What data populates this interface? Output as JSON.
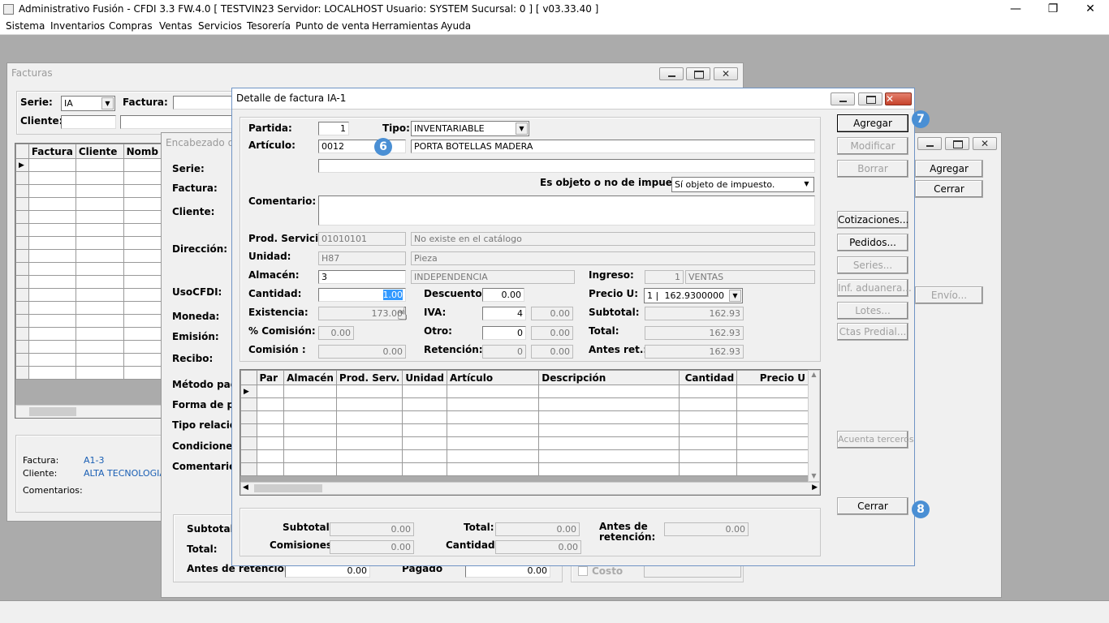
{
  "app": {
    "title": "Administrativo Fusión - CFDI 3.3 FW.4.0 [ TESTVIN23   Servidor: LOCALHOST   Usuario: SYSTEM     Sucursal: 0 ] [ v03.33.40 ]",
    "menu": [
      "Sistema",
      "Inventarios",
      "Compras",
      "Ventas",
      "Servicios",
      "Tesorería",
      "Punto de venta",
      "Herramientas",
      "Ayuda"
    ]
  },
  "facturas": {
    "title": "Facturas",
    "serie_label": "Serie:",
    "serie_value": "IA",
    "factura_label": "Factura:",
    "cliente_label": "Cliente:",
    "columns": [
      "Factura",
      "Cliente",
      "Nomb"
    ],
    "info_factura_label": "Factura:",
    "info_factura_value": "A1-3",
    "info_cliente_label": "Cliente:",
    "info_cliente_value": "ALTA TECNOLOGIA",
    "info_comentarios_label": "Comentarios:"
  },
  "encabezado": {
    "title": "Encabezado de",
    "labels": [
      "Serie:",
      "Factura:",
      "Cliente:",
      "Dirección:",
      "UsoCFDI:",
      "Moneda:",
      "Emisión:",
      "Recibo:",
      "Método pago",
      "Forma de pag",
      "Tipo relación:",
      "Condiciones:",
      "Comentarios"
    ],
    "subtotal_label": "Subtotal:",
    "total_label": "Total:",
    "antes_label": "Antes de retención",
    "antes_value": "0.00",
    "pagado_label": "Pagado",
    "pagado_value": "0.00",
    "costo_label": "Costo",
    "agregar": "Agregar",
    "cerrar": "Cerrar",
    "envio": "Envío..."
  },
  "detalle": {
    "title": "Detalle de factura IA-1",
    "partida_label": "Partida:",
    "partida_value": "1",
    "tipo_label": "Tipo:",
    "tipo_value": "INVENTARIABLE",
    "articulo_label": "Artículo:",
    "articulo_code": "0012",
    "articulo_desc": "PORTA BOTELLAS MADERA",
    "objeto_label": "Es objeto o no de impuesto:",
    "objeto_value": "Sí objeto de impuesto.",
    "comentario_label": "Comentario:",
    "prod_label": "Prod. Servicio:",
    "prod_code": "01010101",
    "prod_desc": "No existe en el catálogo",
    "unidad_label": "Unidad:",
    "unidad_code": "H87",
    "unidad_desc": "Pieza",
    "almacen_label": "Almacén:",
    "almacen_code": "3",
    "almacen_desc": "INDEPENDENCIA",
    "ingreso_label": "Ingreso:",
    "ingreso_code": "1",
    "ingreso_desc": "VENTAS",
    "cantidad_label": "Cantidad:",
    "cantidad_value": "1.00",
    "descuento_label": "Descuento:",
    "descuento_value": "0.00",
    "preciou_label": "Precio U:",
    "preciou_list": "1 |",
    "preciou_value": "162.9300000",
    "existencia_label": "Existencia:",
    "existencia_value": "173.00",
    "iva_label": "IVA:",
    "iva_rate": "4",
    "iva_value": "0.00",
    "subtotal_label": "Subtotal:",
    "subtotal_value": "162.93",
    "comision_pct_label": "% Comisión:",
    "comision_pct_value": "0.00",
    "otro_label": "Otro:",
    "otro_rate": "0",
    "otro_value": "0.00",
    "total_label": "Total:",
    "total_value": "162.93",
    "comision_label": "Comisión :",
    "comision_value": "0.00",
    "retencion_label": "Retención:",
    "retencion_rate": "0",
    "retencion_value": "0.00",
    "antesret_label": "Antes ret.:",
    "antesret_value": "162.93",
    "grid_columns": [
      "Par",
      "Almacén",
      "Prod. Serv.",
      "Unidad",
      "Artículo",
      "Descripción",
      "Cantidad",
      "Precio U"
    ],
    "sum_subtotal_label": "Subtotal:",
    "sum_subtotal_value": "0.00",
    "sum_total_label": "Total:",
    "sum_total_value": "0.00",
    "sum_antes_label": "Antes de retención:",
    "sum_antes_value": "0.00",
    "sum_comisiones_label": "Comisiones:",
    "sum_comisiones_value": "0.00",
    "sum_cantidad_label": "Cantidad:",
    "sum_cantidad_value": "0.00",
    "buttons": {
      "agregar": "Agregar",
      "modificar": "Modificar",
      "borrar": "Borrar",
      "cotizaciones": "Cotizaciones...",
      "pedidos": "Pedidos...",
      "series": "Series...",
      "inf_aduanera": "Inf. aduanera...",
      "lotes": "Lotes...",
      "ctas_predial": "Ctas Predial...",
      "acuenta": "Acuenta terceros",
      "cerrar": "Cerrar"
    },
    "badges": [
      "6",
      "7",
      "8"
    ]
  },
  "colors": {
    "accent": "#4a8fd4",
    "selection": "#3399ff",
    "link": "#1a5fb4"
  }
}
